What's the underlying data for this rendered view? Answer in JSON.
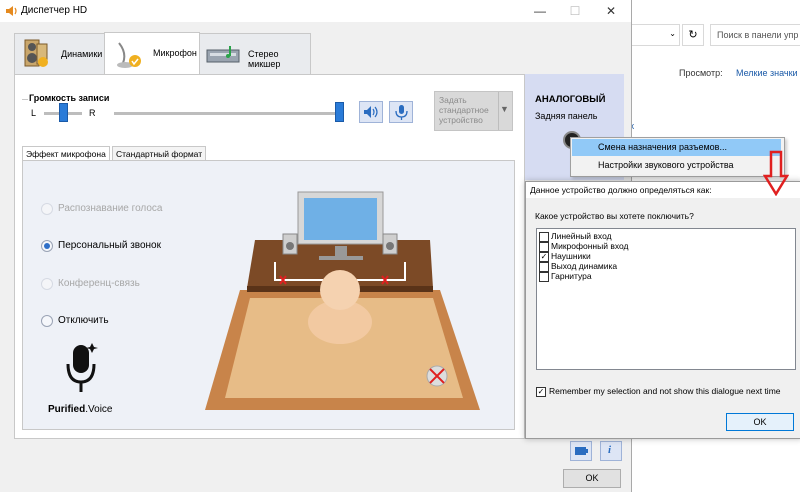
{
  "window": {
    "title": "Диспетчер HD"
  },
  "tabs": [
    {
      "label": "Динамики"
    },
    {
      "label": "Микрофон"
    },
    {
      "label": "Стерео микшер"
    }
  ],
  "volume": {
    "label": "Громкость записи",
    "left": "L",
    "right": "R",
    "balance": 0.5,
    "level": 1.0
  },
  "default_device_button": {
    "line1": "Задать",
    "line2": "стандартное",
    "line3": "устройство"
  },
  "inner_tabs": [
    "Эффект микрофона",
    "Стандартный формат"
  ],
  "effects": [
    {
      "label": "Распознавание голоса",
      "state": "disabled"
    },
    {
      "label": "Персональный звонок",
      "state": "selected"
    },
    {
      "label": "Конференц-связь",
      "state": "disabled"
    },
    {
      "label": "Отключить",
      "state": "normal"
    }
  ],
  "brand": {
    "word1": "Purified",
    "word2": ".Voice"
  },
  "analog": {
    "title": "АНАЛОГОВЫЙ",
    "subtitle": "Задняя панель"
  },
  "context_menu": [
    "Смена назначения разъемов...",
    "Настройки звукового устройства"
  ],
  "dialog": {
    "title": "Данное устройство должно определяться как:",
    "question": "Какое устройство вы хотете поключить?",
    "devices": [
      {
        "label": "Линейный вход",
        "checked": false
      },
      {
        "label": "Микрофонный вход",
        "checked": false
      },
      {
        "label": "Наушники",
        "checked": true
      },
      {
        "label": "Выход динамика",
        "checked": false
      },
      {
        "label": "Гарнитура",
        "checked": false
      }
    ],
    "remember": "Remember my selection and not show this dialogue next time",
    "remember_checked": true,
    "ok": "OK"
  },
  "footer": {
    "ok": "OK"
  },
  "background": {
    "search_placeholder": "Поиск в панели упр",
    "view_label": "Просмотр:",
    "view_value": "Мелкие значки",
    "partial_text": "к"
  },
  "colors": {
    "accent": "#2a7bd8",
    "highlight": "#91c9f7",
    "arrow": "#e02020",
    "panel": "#d6dcf2"
  }
}
